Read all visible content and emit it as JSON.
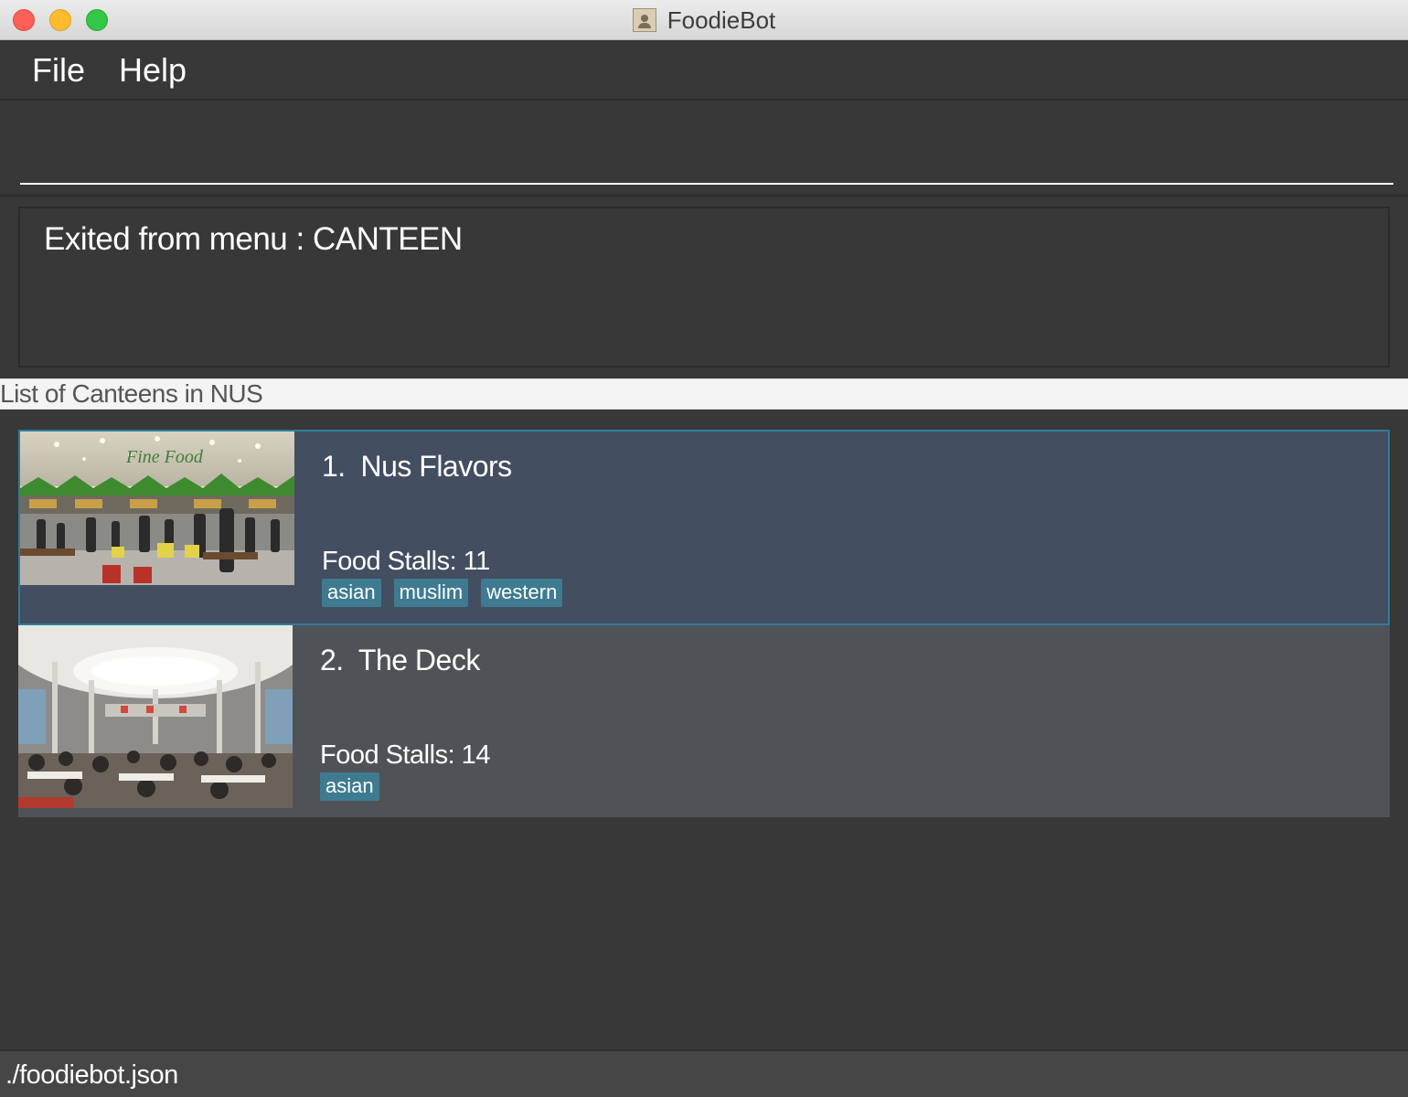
{
  "window": {
    "title": "FoodieBot"
  },
  "menu": {
    "file": "File",
    "help": "Help"
  },
  "command_box": {
    "value": "",
    "placeholder": ""
  },
  "result_display": {
    "text": "Exited from menu : CANTEEN"
  },
  "list": {
    "header": "List of Canteens in NUS",
    "items": [
      {
        "index": "1.",
        "name": "Nus Flavors",
        "stalls_label": "Food Stalls: 11",
        "tags": [
          "asian",
          "muslim",
          "western"
        ],
        "image": "food-court-photo",
        "selected": true
      },
      {
        "index": "2.",
        "name": "The Deck",
        "stalls_label": "Food Stalls: 14",
        "tags": [
          "asian"
        ],
        "image": "canteen-hall-photo",
        "selected": false
      }
    ]
  },
  "status_bar": {
    "path": "./foodiebot.json"
  },
  "colors": {
    "background": "#383838",
    "selected_card": "#434e61",
    "selected_border": "#2f7d9b",
    "card": "#4f5357",
    "tag": "#3e7b91"
  }
}
